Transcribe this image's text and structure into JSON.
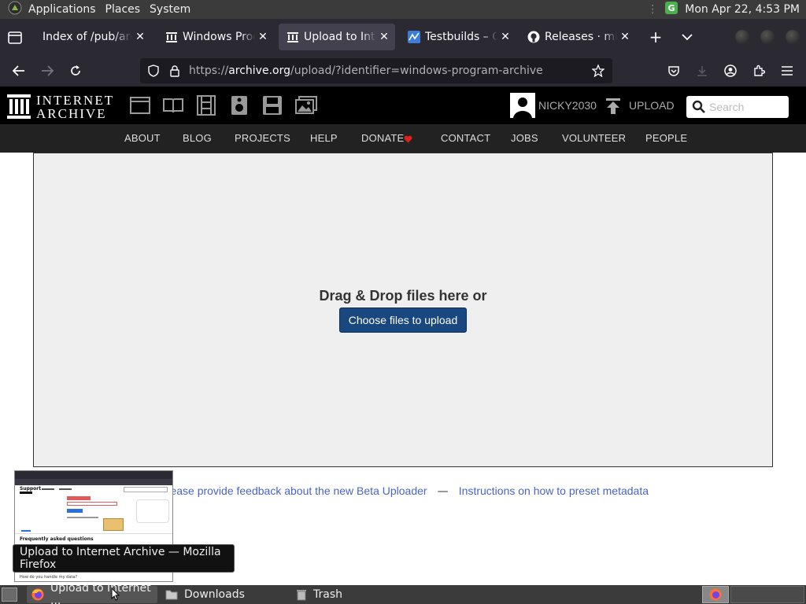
{
  "system_panel": {
    "menu": [
      "Applications",
      "Places",
      "System"
    ],
    "clock": "Mon Apr 22,  4:53 PM"
  },
  "tabs": [
    {
      "title": "Index of /pub/archive",
      "icon": "folder-icon",
      "active": false
    },
    {
      "title": "Windows Program Archive",
      "icon": "archive-icon",
      "active": false
    },
    {
      "title": "Upload to Internet Archive",
      "icon": "archive-icon",
      "active": true
    },
    {
      "title": "Testbuilds – OracleWiki",
      "icon": "wiki-icon",
      "active": false
    },
    {
      "title": "Releases · microsoft",
      "icon": "github-icon",
      "active": false
    }
  ],
  "url": {
    "scheme": "https://",
    "host": "archive.org",
    "path": "/upload/?identifier=windows-program-archive"
  },
  "ia_header": {
    "logo_line1": "INTERNET",
    "logo_line2": "ARCHIVE",
    "username": "NICKY2030",
    "upload_label": "UPLOAD",
    "search_placeholder": "Search"
  },
  "ia_nav": [
    "ABOUT",
    "BLOG",
    "PROJECTS",
    "HELP",
    "DONATE",
    "CONTACT",
    "JOBS",
    "VOLUNTEER",
    "PEOPLE"
  ],
  "dropzone": {
    "text": "Drag & Drop files here or",
    "button": "Choose files to upload"
  },
  "footer_links": {
    "feedback": "Please provide feedback about the new Beta Uploader",
    "separator": "—",
    "instructions": "Instructions on how to preset metadata"
  },
  "tooltip": "Upload to Internet Archive — Mozilla Firefox",
  "thumbnail": {
    "heading": "Frequently asked questions",
    "row": "How do you handle my data?",
    "brand": "Support"
  },
  "taskbar": {
    "tasks": [
      "Upload to Internet ...",
      "Downloads",
      "Trash"
    ]
  },
  "colors": {
    "ia_button": "#194880",
    "link": "#4b64c4",
    "donate_heart": "#e02020"
  }
}
